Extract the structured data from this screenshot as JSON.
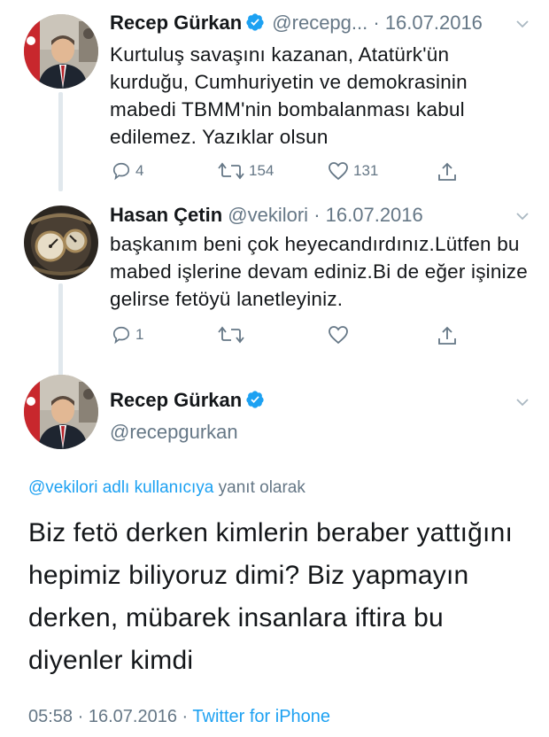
{
  "tweets": [
    {
      "name": "Recep Gürkan",
      "handle": "@recepg...",
      "sep": "·",
      "date": "16.07.2016",
      "text": "Kurtuluş savaşını kazanan, Atatürk'ün kurduğu, Cumhuriyetin ve demokrasinin mabedi TBMM'nin bombalanması kabul edilemez. Yazıklar olsun",
      "replies": "4",
      "retweets": "154",
      "likes": "131",
      "verified": true
    },
    {
      "name": "Hasan Çetin",
      "handle": "@vekilori",
      "sep": "·",
      "date": "16.07.2016",
      "text": "başkanım beni çok heyecandırdınız.Lütfen bu mabed işlerine devam ediniz.Bi de eğer işinize gelirse fetöyü lanetleyiniz.",
      "replies": "1",
      "retweets": "",
      "likes": ""
    }
  ],
  "main": {
    "name": "Recep Gürkan",
    "handle": "@recepgurkan",
    "reply_mention": "@vekilori adlı kullanıcıya",
    "reply_suffix": " yanıt olarak",
    "text": "Biz fetö derken kimlerin beraber yattığını hepimiz biliyoruz dimi? Biz yapmayın derken, mübarek insanlara iftira bu diyenler kimdi",
    "time": "05:58",
    "sep": "·",
    "date": "16.07.2016",
    "source": "Twitter for iPhone"
  },
  "colors": {
    "accent": "#1da1f2",
    "muted": "#657786",
    "text": "#14171a",
    "thread": "#e1e8ed"
  },
  "icons": [
    "verified-icon",
    "chevron-down-icon",
    "reply-icon",
    "retweet-icon",
    "like-icon",
    "share-icon"
  ]
}
